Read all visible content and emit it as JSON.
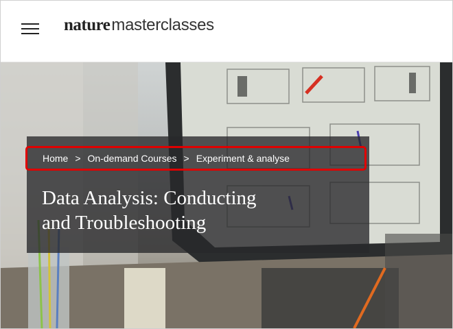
{
  "header": {
    "menu_icon": "hamburger-menu-icon",
    "logo": {
      "nature": "nature",
      "masterclasses": "masterclasses"
    }
  },
  "breadcrumb": {
    "items": [
      "Home",
      "On-demand Courses",
      "Experiment & analyse"
    ],
    "separator": ">",
    "highlight_color": "#e00000"
  },
  "hero": {
    "title_line1": "Data Analysis: Conducting",
    "title_line2": "and Troubleshooting",
    "overlay_color": "#28282a"
  }
}
